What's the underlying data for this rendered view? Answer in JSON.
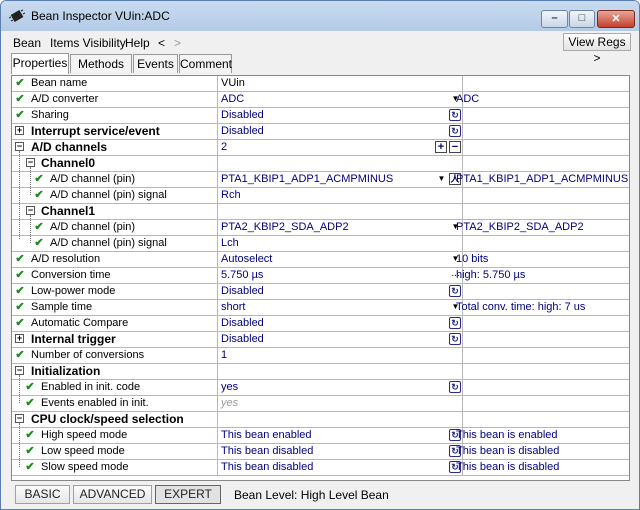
{
  "window": {
    "title": "Bean Inspector VUin:ADC"
  },
  "window_controls": {
    "minimize": "–",
    "maximize": "□",
    "close": "✕"
  },
  "menu": {
    "items": [
      "Bean",
      "Items Visibility",
      "Help"
    ],
    "back": "<",
    "forward": ">"
  },
  "view_regs": {
    "label": "View Regs >"
  },
  "tabs": [
    "Properties",
    "Methods",
    "Events",
    "Comment"
  ],
  "rows": [
    {
      "name": "Bean name",
      "value": "VUin",
      "info": "",
      "check": true
    },
    {
      "name": "A/D converter",
      "value": "ADC",
      "info": "ADC",
      "check": true
    },
    {
      "name": "Sharing",
      "value": "Disabled",
      "info": "",
      "check": true
    },
    {
      "name": "Interrupt service/event",
      "value": "Disabled",
      "info": ""
    },
    {
      "name": "A/D channels",
      "value": "2",
      "info": ""
    },
    {
      "name": "Channel0",
      "value": "",
      "info": ""
    },
    {
      "name": "A/D channel (pin)",
      "value": "PTA1_KBIP1_ADP1_ACMPMINUS",
      "info": "PTA1_KBIP1_ADP1_ACMPMINUS",
      "check": true
    },
    {
      "name": "A/D channel (pin) signal",
      "value": "Rch",
      "info": "",
      "check": true
    },
    {
      "name": "Channel1",
      "value": "",
      "info": ""
    },
    {
      "name": "A/D channel (pin)",
      "value": "PTA2_KBIP2_SDA_ADP2",
      "info": "PTA2_KBIP2_SDA_ADP2",
      "check": true
    },
    {
      "name": "A/D channel (pin) signal",
      "value": "Lch",
      "info": "",
      "check": true
    },
    {
      "name": "A/D resolution",
      "value": "Autoselect",
      "info": "10 bits",
      "check": true
    },
    {
      "name": "Conversion time",
      "value": "5.750 µs",
      "info": "high: 5.750 µs",
      "check": true
    },
    {
      "name": "Low-power mode",
      "value": "Disabled",
      "info": "",
      "check": true
    },
    {
      "name": "Sample time",
      "value": "short",
      "info": "Total conv. time:  high: 7 us",
      "check": true
    },
    {
      "name": "Automatic Compare",
      "value": "Disabled",
      "info": "",
      "check": true
    },
    {
      "name": "Internal trigger",
      "value": "Disabled",
      "info": ""
    },
    {
      "name": "Number of conversions",
      "value": "1",
      "info": "",
      "check": true
    },
    {
      "name": "Initialization",
      "value": "",
      "info": ""
    },
    {
      "name": "Enabled in init. code",
      "value": "yes",
      "info": "",
      "check": true
    },
    {
      "name": "Events enabled in init.",
      "value": "yes",
      "info": "",
      "check": true
    },
    {
      "name": "CPU clock/speed selection",
      "value": "",
      "info": ""
    },
    {
      "name": "High speed mode",
      "value": "This bean enabled",
      "info": "This bean is enabled",
      "check": true
    },
    {
      "name": "Low speed mode",
      "value": "This bean disabled",
      "info": "This bean is disabled",
      "check": true
    },
    {
      "name": "Slow speed mode",
      "value": "This bean disabled",
      "info": "This bean is disabled",
      "check": true
    }
  ],
  "status": {
    "buttons": [
      "BASIC",
      "ADVANCED",
      "EXPERT"
    ],
    "level": "Bean Level: High Level Bean"
  },
  "colors": {
    "check": "#1a8a1a",
    "value_text": "#000080",
    "cycle_icon": "#2a2a8a",
    "titlebar": "#b4cbe6"
  },
  "icons": {
    "check": "✔",
    "expand_plus": "+",
    "expand_minus": "−",
    "dropdown": "▼",
    "cycle": "↻",
    "add": "+",
    "remove": "−",
    "pin": "人",
    "ellipsis": "..."
  }
}
